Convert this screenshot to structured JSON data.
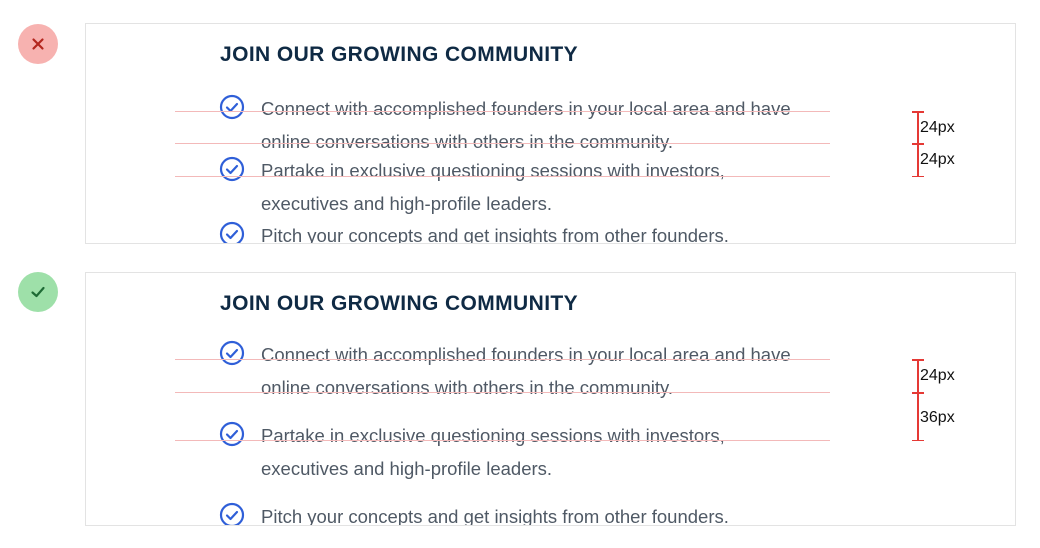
{
  "examples": [
    {
      "status": "bad",
      "status_icon": "close-icon",
      "status_color": "#f7b2b0",
      "heading": "JOIN OUR GROWING COMMUNITY",
      "items": [
        {
          "line1": "Connect with accomplished founders in your local area and have",
          "line2": "online conversations with others in the community."
        },
        {
          "line1": "Partake in exclusive questioning sessions with investors,",
          "line2": "executives and high-profile leaders."
        },
        {
          "line1": "Pitch your concepts and get insights from other founders.",
          "line2": ""
        }
      ],
      "measurements": [
        "24px",
        "24px"
      ]
    },
    {
      "status": "good",
      "status_icon": "check-icon",
      "status_color": "#9ee0a9",
      "heading": "JOIN OUR GROWING COMMUNITY",
      "items": [
        {
          "line1": "Connect with accomplished founders in your local area and have",
          "line2": "online conversations with others in the community."
        },
        {
          "line1": "Partake in exclusive questioning sessions with investors,",
          "line2": "executives and high-profile leaders."
        },
        {
          "line1": "Pitch your concepts and get insights from other founders.",
          "line2": ""
        }
      ],
      "measurements": [
        "24px",
        "36px"
      ]
    }
  ],
  "colors": {
    "heading": "#0f2a44",
    "body_text": "#4f5965",
    "check_icon": "#2f5fd8",
    "measure_line": "#e53935",
    "guide_line": "#f3b9b9"
  }
}
